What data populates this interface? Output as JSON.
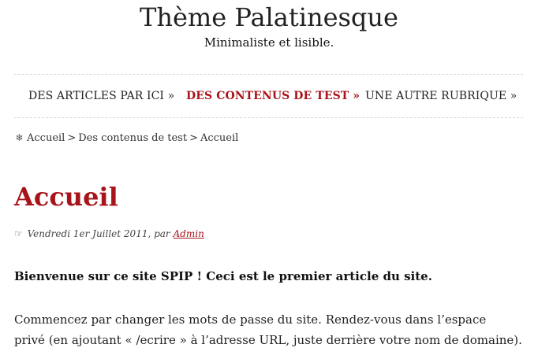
{
  "header": {
    "site_title": "Thème Palatinesque",
    "tagline": "Minimaliste et lisible."
  },
  "nav": {
    "items": [
      {
        "label": "DES ARTICLES PAR ICI »",
        "active": false
      },
      {
        "label": "DES CONTENUS DE TEST »",
        "active": true
      },
      {
        "label": "UNE AUTRE RUBRIQUE »",
        "active": false
      }
    ]
  },
  "breadcrumb": {
    "icon": "snowflake-icon",
    "icon_glyph": "❄",
    "items": [
      "Accueil",
      "Des contenus de test",
      "Accueil"
    ],
    "separator": ">"
  },
  "article": {
    "title": "Accueil",
    "meta": {
      "icon_glyph": "☞",
      "date_text": "Vendredi 1er Juillet 2011, par",
      "author": "Admin"
    },
    "lead": "Bienvenue sur ce site SPIP ! Ceci est le premier article du site.",
    "paragraph_lines": [
      "Commencez par changer les mots de passe du site. Rendez-vous dans l’espace",
      "privé (en ajoutant « /ecrire » à l’adresse URL, juste derrière votre nom de domaine)."
    ]
  },
  "colors": {
    "accent": "#a8141b",
    "text": "#222222",
    "rule": "#d9d9d9"
  }
}
